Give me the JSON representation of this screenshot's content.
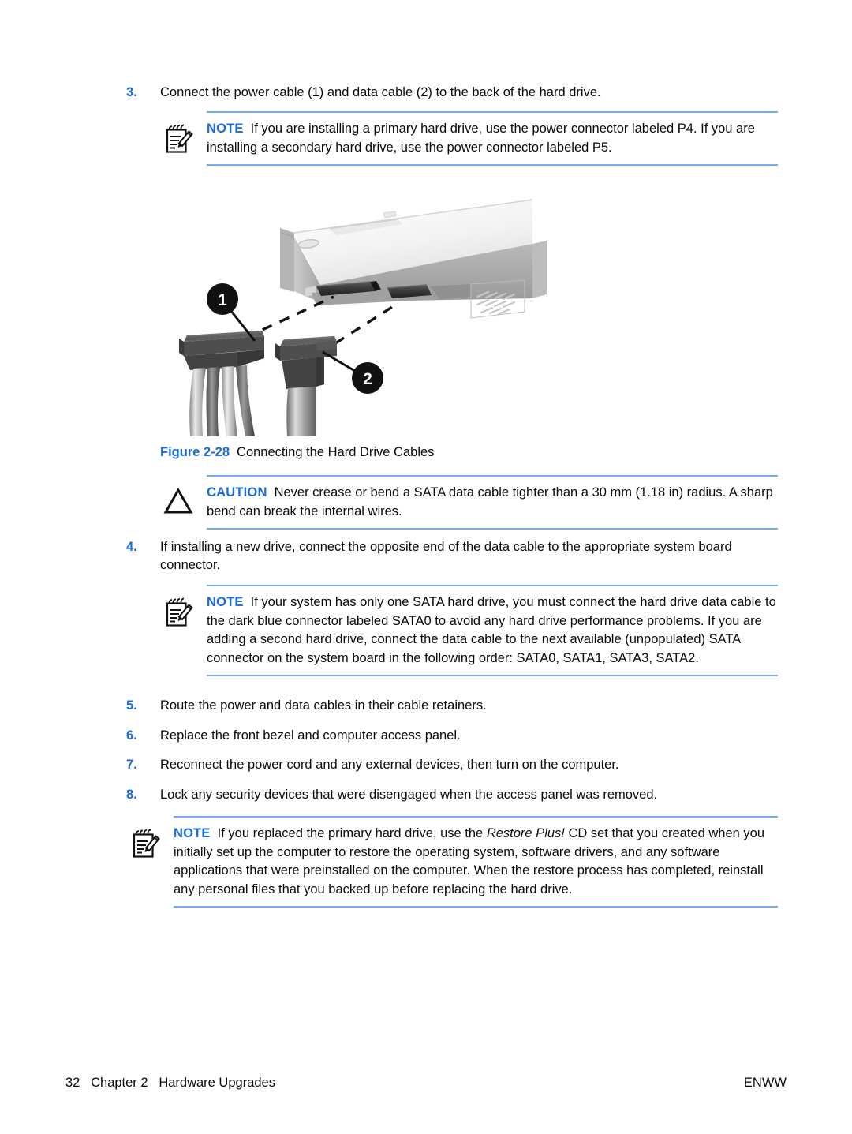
{
  "document": {
    "page_number": "32",
    "chapter": "Chapter 2",
    "chapter_title": "Hardware Upgrades",
    "footer_right": "ENWW",
    "footer_left": "32   Chapter 2   Hardware Upgrades"
  },
  "colors": {
    "accent_blue": "#1a6ae0",
    "rule_blue": "#74aaf6",
    "body_text": "#0a0a0a"
  },
  "steps": [
    {
      "number": "3.",
      "text": "Connect the power cable (1) and data cable (2) to the back of the hard drive."
    },
    {
      "number": "4.",
      "text": "If installing a new drive, connect the opposite end of the data cable to the appropriate system board connector."
    },
    {
      "number": "5.",
      "text": "Route the power and data cables in their cable retainers."
    },
    {
      "number": "6.",
      "text": "Replace the front bezel and computer access panel."
    },
    {
      "number": "7.",
      "text": "Reconnect the power cord and any external devices, then turn on the computer."
    },
    {
      "number": "8.",
      "text": "Lock any security devices that were disengaged when the access panel was removed."
    }
  ],
  "admonitions": {
    "note_1": {
      "label": "NOTE",
      "icon": "note-pencil-icon",
      "text": "If you are installing a primary hard drive, use the power connector labeled P4. If you are installing a secondary hard drive, use the power connector labeled P5."
    },
    "caution_1": {
      "label": "CAUTION",
      "icon": "caution-triangle-icon",
      "text": "Never crease or bend a SATA data cable tighter than a 30 mm (1.18 in) radius. A sharp bend can break the internal wires."
    },
    "note_2": {
      "label": "NOTE",
      "icon": "note-pencil-icon",
      "text": "If your system has only one SATA hard drive, you must connect the hard drive data cable to the dark blue connector labeled SATA0 to avoid any hard drive performance problems. If you are adding a second hard drive, connect the data cable to the next available (unpopulated) SATA connector on the system board in the following order: SATA0, SATA1, SATA3, SATA2."
    },
    "note_3": {
      "label": "NOTE",
      "icon": "note-pencil-icon",
      "text_part1": "If you replaced the primary hard drive, use the ",
      "text_italic": "Restore Plus!",
      "text_part2": " CD set that you created when you initially set up the computer to restore the operating system, software drivers, and any software applications that were preinstalled on the computer. When the restore process has completed, reinstall any personal files that you backed up before replacing the hard drive."
    }
  },
  "figure": {
    "number": "Figure 2-28",
    "title": "Connecting the Hard Drive Cables",
    "alt": "Hard drive rear showing SATA power and data connectors with cables",
    "callouts": [
      {
        "id": "1",
        "meaning": "power cable"
      },
      {
        "id": "2",
        "meaning": "data cable"
      }
    ]
  }
}
